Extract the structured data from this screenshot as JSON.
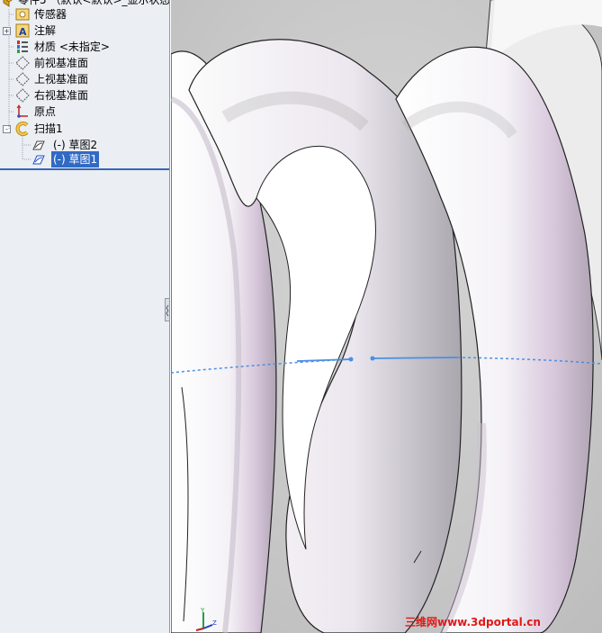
{
  "feature_tree": {
    "root": {
      "label": "零件5 （默认<默认>_显示状态",
      "icon": "part-icon"
    },
    "items": [
      {
        "label": "传感器",
        "icon": "sensors-folder-icon"
      },
      {
        "label": "注解",
        "icon": "annotations-icon"
      },
      {
        "label": "材质 <未指定>",
        "icon": "material-icon"
      },
      {
        "label": "前视基准面",
        "icon": "plane-icon"
      },
      {
        "label": "上视基准面",
        "icon": "plane-icon"
      },
      {
        "label": "右视基准面",
        "icon": "plane-icon"
      },
      {
        "label": "原点",
        "icon": "origin-icon"
      },
      {
        "label": "扫描1",
        "icon": "sweep-feature-icon"
      },
      {
        "label": "(-) 草图2",
        "icon": "sketch-icon"
      },
      {
        "label": "(-) 草图1",
        "icon": "sketch-icon"
      }
    ],
    "expander_plus": "+",
    "expander_minus": "-"
  },
  "triad": {
    "y_label": "Y",
    "z_label": "Z"
  },
  "watermark": "三维网www.3dportal.cn",
  "colors": {
    "selection": "#316ac5",
    "sketch_line": "#4a90e2",
    "panel_bg": "#ebeef3",
    "watermark": "#e01818"
  }
}
